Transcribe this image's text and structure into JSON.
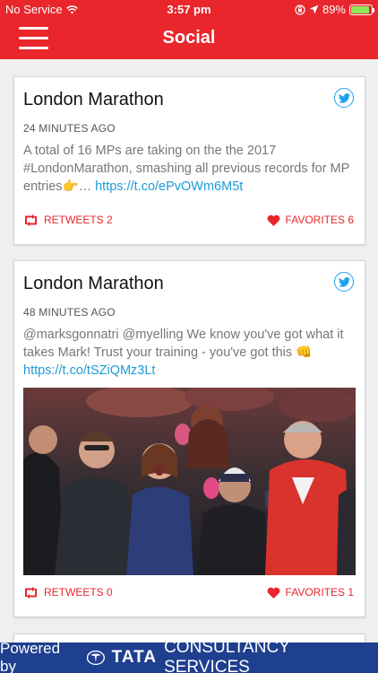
{
  "status_bar": {
    "carrier": "No Service",
    "time": "3:57 pm",
    "battery": "89%",
    "battery_level": 0.89
  },
  "nav": {
    "title": "Social"
  },
  "tweets": [
    {
      "title": "London Marathon",
      "time": "24 MINUTES AGO",
      "text": "A total of 16 MPs are taking on the the 2017 #LondonMarathon, smashing all previous records for MP entries👉… ",
      "link": "https://t.co/ePvOWm6M5t",
      "retweets": "RETWEETS 2",
      "favorites": "FAVORITES 6"
    },
    {
      "title": "London Marathon",
      "time": "48 MINUTES AGO",
      "text": "@marksgonnatri @myelling We know you've got what it takes Mark! Trust your training - you've got this 👊 ",
      "link": "https://t.co/tSZiQMz3Lt",
      "retweets": "RETWEETS 0",
      "favorites": "FAVORITES 1"
    }
  ],
  "footer": {
    "powered": "Powered by",
    "brand": "TATA",
    "company": "CONSULTANCY SERVICES"
  },
  "colors": {
    "accent": "#e8262c",
    "twitter": "#1da1f2",
    "link": "#1e9bd7",
    "footer": "#1f3f8f"
  }
}
